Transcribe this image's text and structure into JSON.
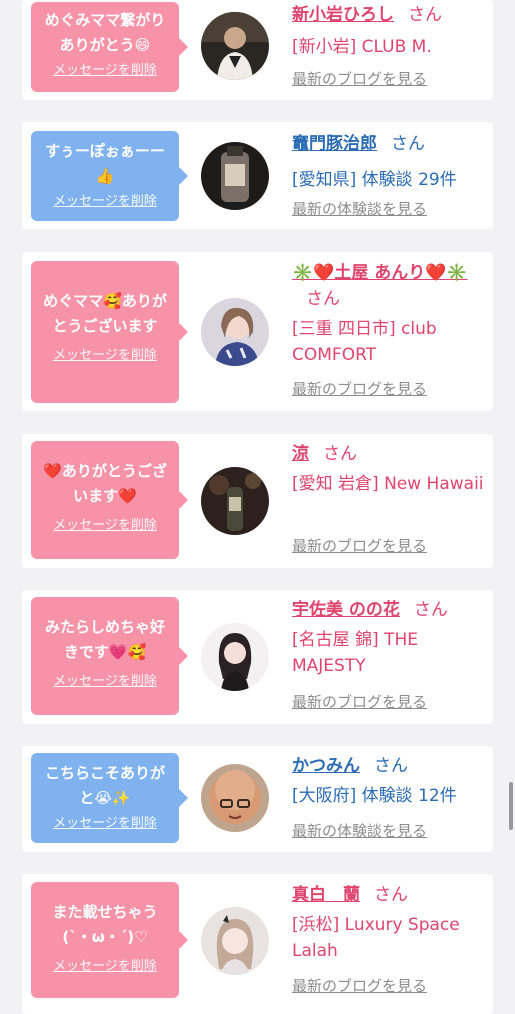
{
  "items": [
    {
      "message": "めぐみママ繋がりありがとう😄",
      "delete_label": "メッセージを削除",
      "bubble_color": "#f793a8",
      "name": "新小岩ひろし",
      "honorific": "さん",
      "shop": "[新小岩] CLUB M.",
      "link": "最新のブログを見る",
      "type": "pink"
    },
    {
      "message": "すぅーぽぉぁーー👍",
      "delete_label": "メッセージを削除",
      "bubble_color": "#7fb2ef",
      "name": "竈門豚治郎",
      "honorific": "さん",
      "shop": "[愛知県] 体験談 29件",
      "link": "最新の体験談を見る",
      "type": "blue"
    },
    {
      "message": "めぐママ🥰ありがとうございます",
      "delete_label": "メッセージを削除",
      "bubble_color": "#f793a8",
      "name": "✳️❤️土屋 あんり❤️✳️",
      "honorific": "さん",
      "shop": "[三重 四日市] club COMFORT",
      "link": "最新のブログを見る",
      "type": "pink"
    },
    {
      "message": "❤️ありがとうございます❤️",
      "delete_label": "メッセージを削除",
      "bubble_color": "#f793a8",
      "name": "涼",
      "honorific": "さん",
      "shop": "[愛知 岩倉] New Hawaii",
      "link": "最新のブログを見る",
      "type": "pink"
    },
    {
      "message": "みたらしめちゃ好きです💗🥰",
      "delete_label": "メッセージを削除",
      "bubble_color": "#f793a8",
      "name": "宇佐美 のの花",
      "honorific": "さん",
      "shop": "[名古屋 錦] THE MAJESTY",
      "link": "最新のブログを見る",
      "type": "pink"
    },
    {
      "message": "こちらこそありがと😭✨",
      "delete_label": "メッセージを削除",
      "bubble_color": "#7fb2ef",
      "name": "かつみん",
      "honorific": "さん",
      "shop": "[大阪府] 体験談 12件",
      "link": "最新の体験談を見る",
      "type": "blue"
    },
    {
      "message": "また載せちゃう(`・ω・´)♡",
      "delete_label": "メッセージを削除",
      "bubble_color": "#f793a8",
      "name": "真白　蘭",
      "honorific": "さん",
      "shop": "[浜松] Luxury Space Lalah",
      "link": "最新のブログを見る",
      "type": "pink"
    }
  ],
  "colors": {
    "pink_text": "#e0446e",
    "blue_text": "#2b6cb5",
    "gray_link": "#8c8c8c",
    "background": "#f2f2f4"
  }
}
